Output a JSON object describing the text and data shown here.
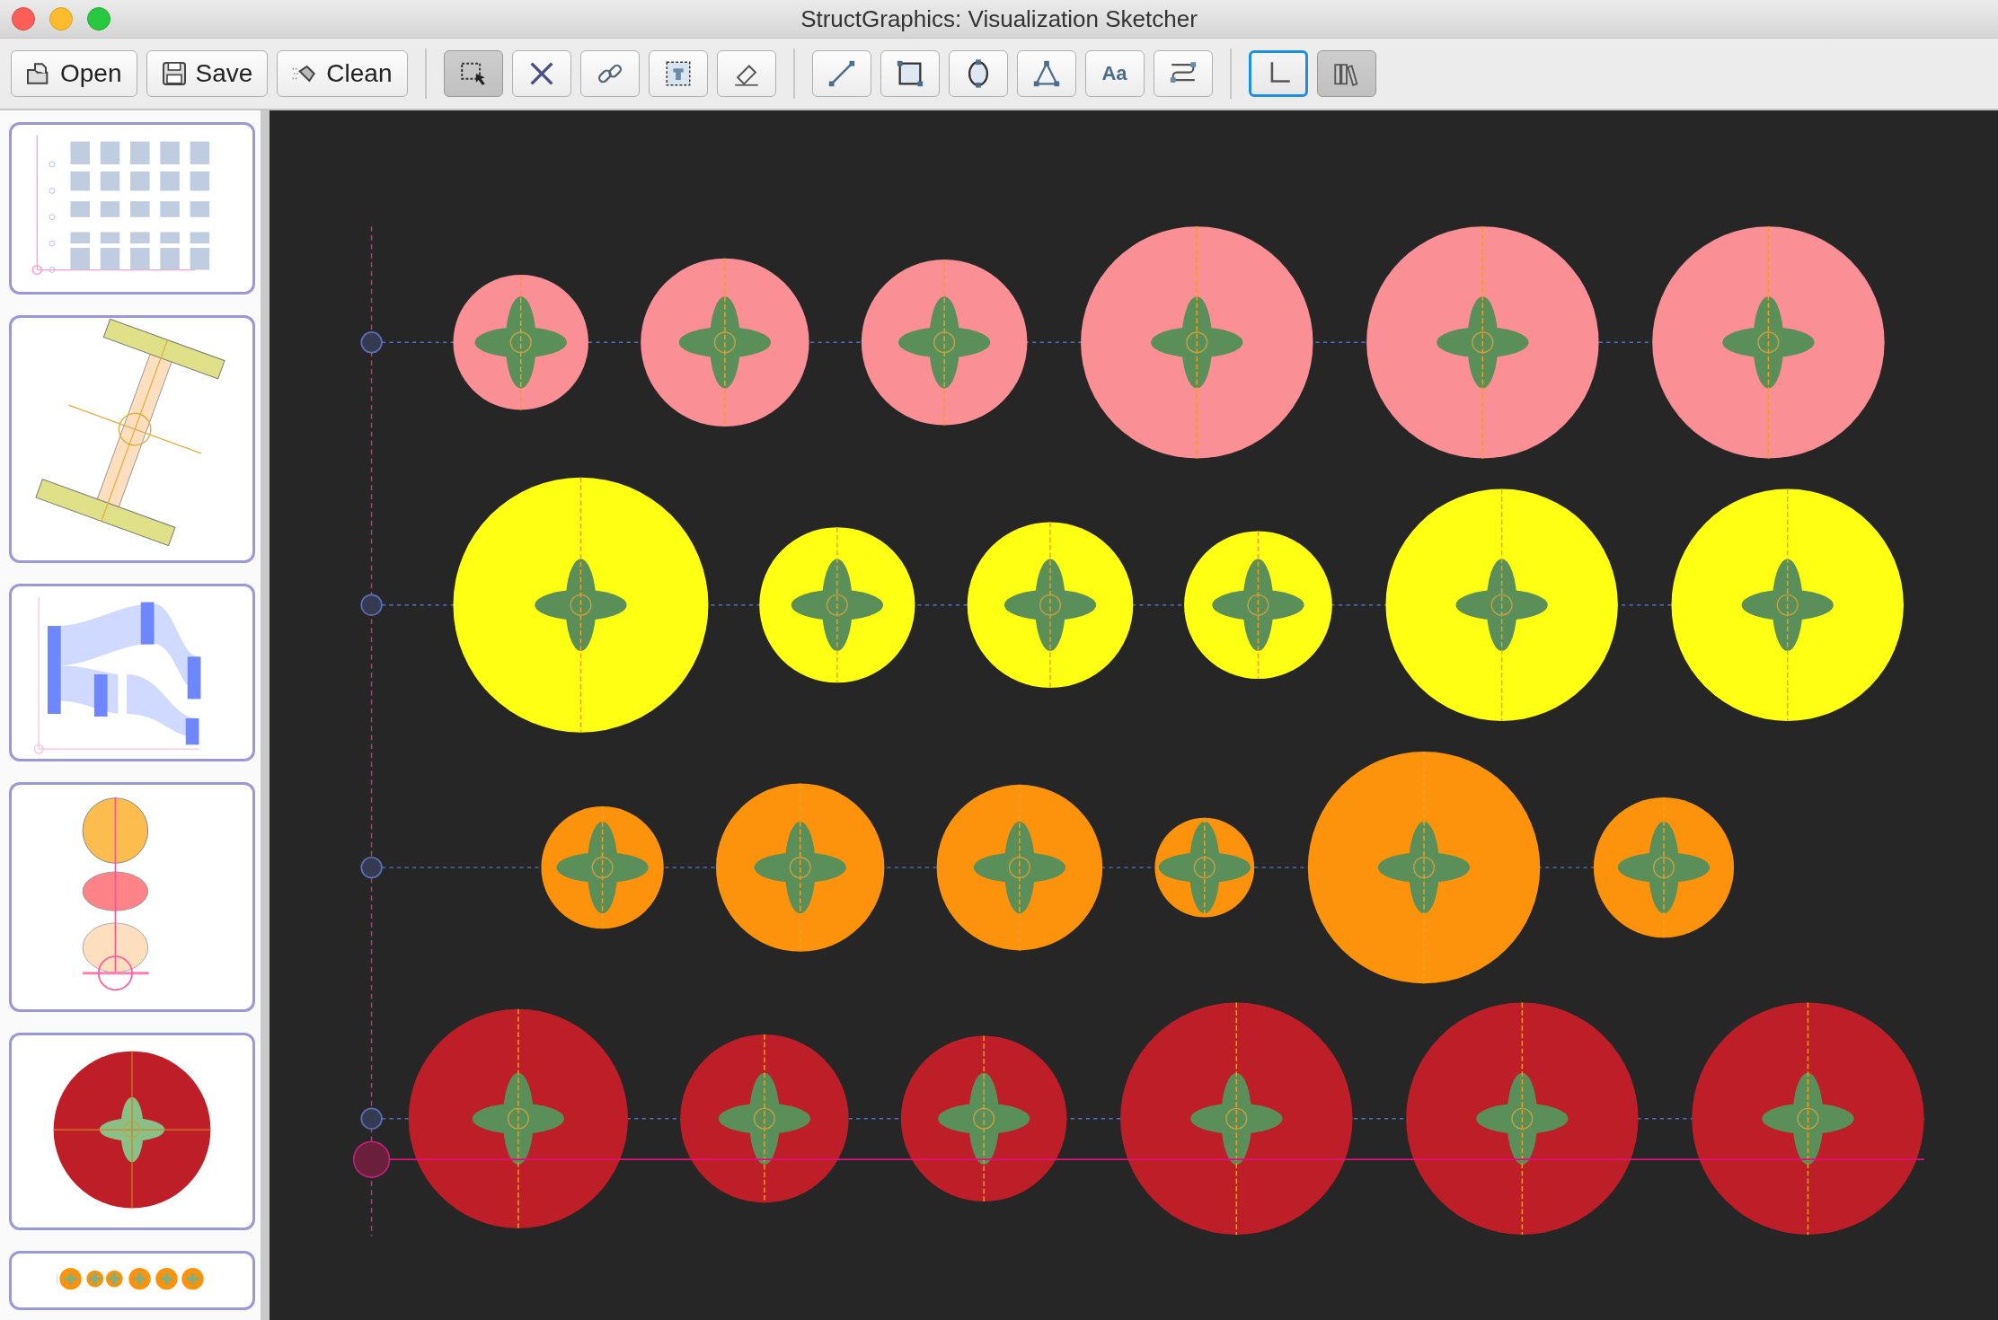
{
  "window": {
    "title": "StructGraphics: Visualization Sketcher"
  },
  "toolbar": {
    "file_buttons": [
      {
        "kind": "open",
        "label": "Open"
      },
      {
        "kind": "save",
        "label": "Save"
      },
      {
        "kind": "clean",
        "label": "Clean"
      }
    ],
    "tool_groups": [
      [
        {
          "kind": "select",
          "selected": true,
          "focused": false
        },
        {
          "kind": "delete",
          "selected": false,
          "focused": false
        },
        {
          "kind": "link",
          "selected": false,
          "focused": false
        },
        {
          "kind": "group",
          "selected": false,
          "focused": false
        },
        {
          "kind": "erase",
          "selected": false,
          "focused": false
        }
      ],
      [
        {
          "kind": "line",
          "selected": false,
          "focused": false
        },
        {
          "kind": "rect",
          "selected": false,
          "focused": false
        },
        {
          "kind": "ellipse",
          "selected": false,
          "focused": false
        },
        {
          "kind": "polygon",
          "selected": false,
          "focused": false
        },
        {
          "kind": "text",
          "glyph": "Aa",
          "selected": false,
          "focused": false
        },
        {
          "kind": "align",
          "selected": false,
          "focused": false
        }
      ],
      [
        {
          "kind": "axis",
          "selected": false,
          "focused": true
        },
        {
          "kind": "library",
          "selected": true,
          "focused": false
        }
      ]
    ]
  }
}
